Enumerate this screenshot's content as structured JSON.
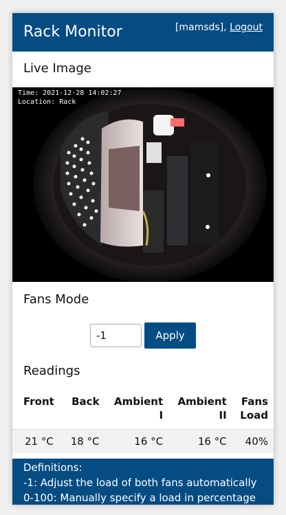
{
  "header": {
    "title": "Rack Monitor",
    "user": "[mamsds],",
    "logout_label": "Logout"
  },
  "live_image": {
    "heading": "Live Image",
    "time_text": "Time: 2021-12-28 14:02:27",
    "location_text": "Location: Rack"
  },
  "fans": {
    "heading": "Fans Mode",
    "value": "-1",
    "apply_label": "Apply"
  },
  "readings": {
    "heading": "Readings",
    "columns": [
      [
        "Front"
      ],
      [
        "Back"
      ],
      [
        "Ambient",
        "I"
      ],
      [
        "Ambient",
        "II"
      ],
      [
        "Fans",
        "Load"
      ]
    ],
    "values": [
      "21 °C",
      "18 °C",
      "16 °C",
      "16 °C",
      "40%"
    ]
  },
  "definitions": {
    "title": "Definitions:",
    "lines": [
      "-1: Adjust the load of both fans automatically",
      "0-100: Manually specify a load in percentage"
    ]
  },
  "colors": {
    "primary": "#054c83",
    "background": "#f0f0f0"
  }
}
